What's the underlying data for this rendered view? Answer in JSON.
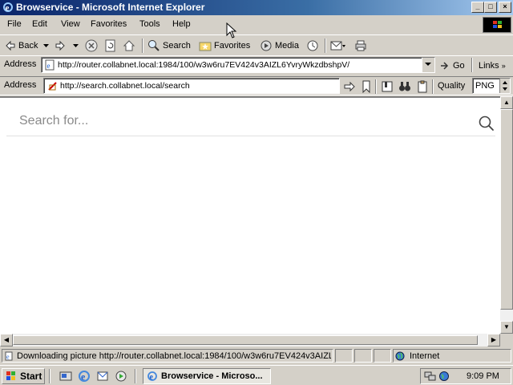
{
  "window": {
    "title": "Browservice - Microsoft Internet Explorer",
    "controls": {
      "minimize": "_",
      "maximize": "□",
      "close": "×"
    }
  },
  "menubar": {
    "items": [
      "File",
      "Edit",
      "View",
      "Favorites",
      "Tools",
      "Help"
    ]
  },
  "toolbar": {
    "back": "Back",
    "search": "Search",
    "favorites": "Favorites",
    "media": "Media"
  },
  "address_bar": {
    "label": "Address",
    "url": "http://router.collabnet.local:1984/100/w3w6ru7EV424v3AIZL6YvryWkzdbshpV/",
    "go": "Go",
    "links": "Links"
  },
  "browservice_bar": {
    "label": "Address",
    "url": "http://search.collabnet.local/search",
    "quality_label": "Quality",
    "quality_value": "PNG"
  },
  "page": {
    "search_placeholder": "Search for..."
  },
  "statusbar": {
    "message": "Downloading picture http://router.collabnet.local:1984/100/w3w6ru7EV424v3AIZL",
    "zone": "Internet"
  },
  "taskbar": {
    "start": "Start",
    "task": "Browservice - Microso...",
    "clock": "9:09 PM"
  },
  "colors": {
    "titlebar_start": "#0a246a",
    "titlebar_end": "#a6caf0",
    "chrome": "#d4d0c8"
  }
}
